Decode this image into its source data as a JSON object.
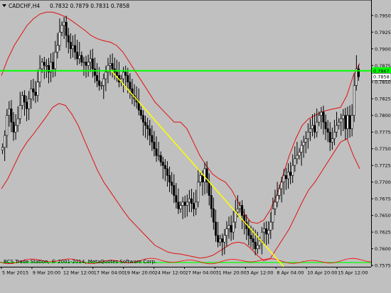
{
  "window": {
    "symbol_label": "CADCHF,H4",
    "quote": "0.7832 0.7879 0.7831 0.7858",
    "footer": "BCS Trade Station, © 2001-2014, MetaQuotes Software Corp.",
    "menu_icon": "triangle-down-icon"
  },
  "chart_data": {
    "type": "candlestick",
    "symbol": "CADCHF",
    "timeframe": "H4",
    "ylim": [
      0.7573,
      0.797
    ],
    "y_ticks": [
      0.795,
      0.7925,
      0.79,
      0.7875,
      0.785,
      0.7825,
      0.78,
      0.7775,
      0.775,
      0.7725,
      0.77,
      0.7675,
      0.765,
      0.7625,
      0.76,
      0.7575
    ],
    "y_tick_labels": [
      "0.7950",
      "0.7925",
      "0.7900",
      "0.7875",
      "0.7850",
      "0.7825",
      "0.7800",
      "0.7775",
      "0.7750",
      "0.7725",
      "0.7700",
      "0.7675",
      "0.7650",
      "0.7625",
      "0.7600",
      "0.7575"
    ],
    "x_tick_labels": [
      "5 Mar 2015",
      "9 Mar 20:00",
      "12 Mar 12:00",
      "17 Mar 04:00",
      "19 Mar 20:00",
      "24 Mar 12:00",
      "27 Mar 04:00",
      "31 Mar 20:00",
      "3 Apr 12:00",
      "8 Apr 04:00",
      "10 Apr 20:00",
      "15 Apr 12:00"
    ],
    "current_price": 0.7858,
    "current_price_label": "0.7858",
    "horizontal_level": 0.7867,
    "horizontal_level_label": "0.7867",
    "colors": {
      "background": "#c0c0c0",
      "bull": "#ffffff",
      "bear": "#000000",
      "wick": "#000000",
      "bands": "#e01010",
      "level_line": "#00ff00",
      "trend_line": "#ffff00",
      "indicator": "#ff0000",
      "axis_text": "#000000"
    },
    "trend_line": {
      "from": [
        "17 Mar 04:00",
        0.7867
      ],
      "to": [
        "8 Apr 04:00",
        0.7573
      ]
    },
    "close": [
      0.7752,
      0.777,
      0.78,
      0.781,
      0.779,
      0.7775,
      0.7785,
      0.7795,
      0.7815,
      0.783,
      0.782,
      0.781,
      0.7825,
      0.784,
      0.7835,
      0.783,
      0.785,
      0.787,
      0.788,
      0.7875,
      0.7875,
      0.7865,
      0.788,
      0.787,
      0.7895,
      0.7905,
      0.7925,
      0.7935,
      0.794,
      0.792,
      0.791,
      0.79,
      0.7905,
      0.7895,
      0.7885,
      0.789,
      0.788,
      0.788,
      0.7875,
      0.788,
      0.7885,
      0.787,
      0.786,
      0.7852,
      0.7845,
      0.7845,
      0.7855,
      0.7865,
      0.7875,
      0.7878,
      0.787,
      0.7865,
      0.786,
      0.785,
      0.7855,
      0.7865,
      0.786,
      0.785,
      0.784,
      0.783,
      0.7825,
      0.782,
      0.7808,
      0.78,
      0.779,
      0.7785,
      0.778,
      0.777,
      0.776,
      0.775,
      0.774,
      0.774,
      0.773,
      0.7725,
      0.772,
      0.771,
      0.77,
      0.7695,
      0.768,
      0.767,
      0.766,
      0.7665,
      0.767,
      0.7665,
      0.767,
      0.7675,
      0.7668,
      0.766,
      0.767,
      0.77,
      0.771,
      0.77,
      0.772,
      0.77,
      0.768,
      0.766,
      0.764,
      0.762,
      0.761,
      0.7615,
      0.761,
      0.762,
      0.763,
      0.7635,
      0.7625,
      0.764,
      0.7655,
      0.766,
      0.7665,
      0.765,
      0.764,
      0.763,
      0.762,
      0.7615,
      0.761,
      0.76,
      0.7605,
      0.7612,
      0.7625,
      0.763,
      0.7622,
      0.7628,
      0.764,
      0.766,
      0.767,
      0.768,
      0.769,
      0.77,
      0.771,
      0.7705,
      0.7715,
      0.771,
      0.7725,
      0.7735,
      0.774,
      0.7745,
      0.7755,
      0.776,
      0.7765,
      0.7775,
      0.778,
      0.7785,
      0.7775,
      0.779,
      0.78,
      0.7805,
      0.779,
      0.778,
      0.7775,
      0.776,
      0.7765,
      0.7775,
      0.7785,
      0.779,
      0.7795,
      0.78,
      0.778,
      0.78,
      0.778,
      0.78,
      0.7845,
      0.787,
      0.7858
    ],
    "upper_band": [
      0.786,
      0.7885,
      0.7905,
      0.792,
      0.7935,
      0.7945,
      0.7952,
      0.7955,
      0.7955,
      0.7952,
      0.7948,
      0.7942,
      0.7935,
      0.7928,
      0.792,
      0.7915,
      0.7912,
      0.791,
      0.7905,
      0.7895,
      0.788,
      0.7865,
      0.785,
      0.7835,
      0.782,
      0.781,
      0.78,
      0.779,
      0.779,
      0.778,
      0.776,
      0.774,
      0.7725,
      0.7712,
      0.7705,
      0.77,
      0.7688,
      0.767,
      0.7652,
      0.764,
      0.7638,
      0.7643,
      0.7658,
      0.768,
      0.771,
      0.774,
      0.7765,
      0.7785,
      0.7795,
      0.78,
      0.7805,
      0.7808,
      0.781,
      0.7812,
      0.783,
      0.786,
      0.7878
    ],
    "lower_band": [
      0.769,
      0.7705,
      0.7725,
      0.7745,
      0.776,
      0.7772,
      0.7785,
      0.7798,
      0.7812,
      0.7818,
      0.7815,
      0.7802,
      0.7785,
      0.7762,
      0.774,
      0.7718,
      0.77,
      0.7686,
      0.7672,
      0.7658,
      0.7645,
      0.7635,
      0.7625,
      0.7615,
      0.7605,
      0.76,
      0.7595,
      0.7593,
      0.7592,
      0.759,
      0.7588,
      0.7586,
      0.7587,
      0.759,
      0.7596,
      0.7602,
      0.7608,
      0.761,
      0.7608,
      0.76,
      0.759,
      0.7582,
      0.7585,
      0.76,
      0.7615,
      0.763,
      0.765,
      0.767,
      0.7688,
      0.77,
      0.7715,
      0.773,
      0.7745,
      0.776,
      0.7765,
      0.774,
      0.772
    ]
  }
}
